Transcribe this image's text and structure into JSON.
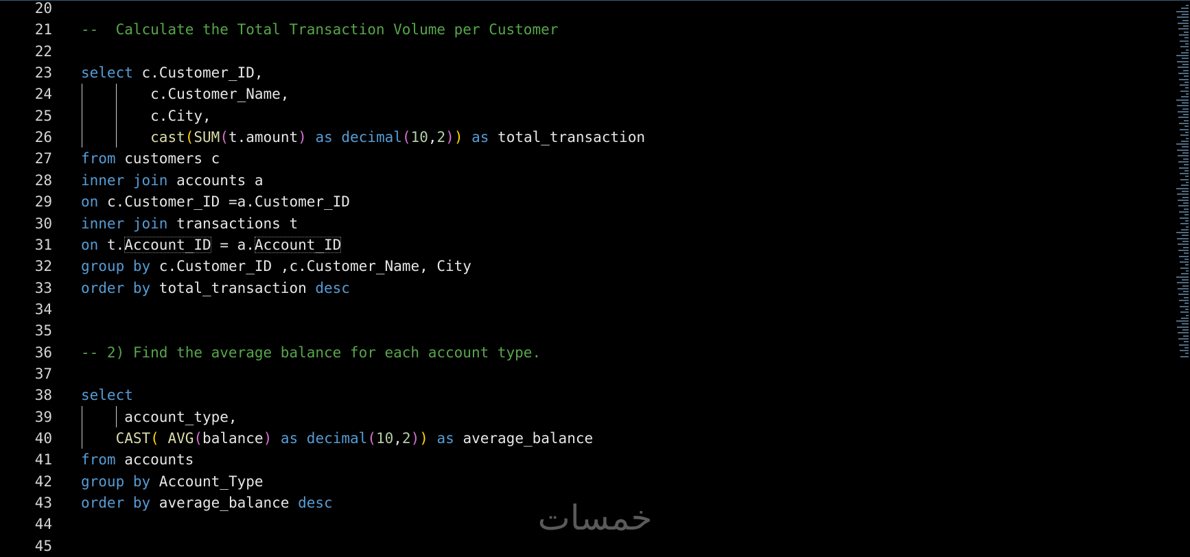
{
  "lines": [
    {
      "n": "20",
      "tokens": []
    },
    {
      "n": "21",
      "tokens": [
        {
          "t": "--  Calculate the Total Transaction Volume per Customer",
          "c": "cm"
        }
      ]
    },
    {
      "n": "22",
      "tokens": []
    },
    {
      "n": "23",
      "tokens": [
        {
          "t": "select",
          "c": "kw"
        },
        {
          "t": " c.Customer_ID,",
          "c": ""
        }
      ]
    },
    {
      "n": "24",
      "indent": "        ",
      "tokens": [
        {
          "t": "c.Customer_Name,",
          "c": ""
        }
      ]
    },
    {
      "n": "25",
      "indent": "        ",
      "tokens": [
        {
          "t": "c.City,",
          "c": ""
        }
      ]
    },
    {
      "n": "26",
      "indent": "        ",
      "tokens": [
        {
          "t": "cast",
          "c": "fn"
        },
        {
          "t": "(",
          "c": "p1"
        },
        {
          "t": "SUM",
          "c": "fn"
        },
        {
          "t": "(",
          "c": "p2"
        },
        {
          "t": "t.amount",
          "c": ""
        },
        {
          "t": ")",
          "c": "p2"
        },
        {
          "t": " as ",
          "c": "kw"
        },
        {
          "t": "decimal",
          "c": "kw"
        },
        {
          "t": "(",
          "c": "p2"
        },
        {
          "t": "10",
          "c": "num"
        },
        {
          "t": ",",
          "c": ""
        },
        {
          "t": "2",
          "c": "num"
        },
        {
          "t": ")",
          "c": "p2"
        },
        {
          "t": ")",
          "c": "p1"
        },
        {
          "t": " as",
          "c": "kw"
        },
        {
          "t": " total_transaction",
          "c": ""
        }
      ]
    },
    {
      "n": "27",
      "tokens": [
        {
          "t": "from",
          "c": "kw"
        },
        {
          "t": " customers c",
          "c": ""
        }
      ]
    },
    {
      "n": "28",
      "tokens": [
        {
          "t": "inner join",
          "c": "kw"
        },
        {
          "t": " accounts a",
          "c": ""
        }
      ]
    },
    {
      "n": "29",
      "tokens": [
        {
          "t": "on",
          "c": "kw"
        },
        {
          "t": " c.Customer_ID =a.Customer_ID",
          "c": ""
        }
      ]
    },
    {
      "n": "30",
      "tokens": [
        {
          "t": "inner join",
          "c": "kw"
        },
        {
          "t": " transactions t",
          "c": ""
        }
      ]
    },
    {
      "n": "31",
      "tokens": [
        {
          "t": "on",
          "c": "kw"
        },
        {
          "t": " t.",
          "c": ""
        },
        {
          "t": "Account_ID",
          "c": "",
          "hl": true
        },
        {
          "t": " = a.",
          "c": ""
        },
        {
          "t": "Account_ID",
          "c": "",
          "hl": true
        }
      ]
    },
    {
      "n": "32",
      "tokens": [
        {
          "t": "group by",
          "c": "kw"
        },
        {
          "t": " c.Customer_ID ,c.Customer_Name, City",
          "c": ""
        }
      ]
    },
    {
      "n": "33",
      "tokens": [
        {
          "t": "order by",
          "c": "kw"
        },
        {
          "t": " total_transaction ",
          "c": ""
        },
        {
          "t": "desc",
          "c": "kw"
        }
      ]
    },
    {
      "n": "34",
      "tokens": []
    },
    {
      "n": "35",
      "tokens": []
    },
    {
      "n": "36",
      "tokens": [
        {
          "t": "-- 2) Find the average balance for each account type.",
          "c": "cm"
        }
      ]
    },
    {
      "n": "37",
      "tokens": []
    },
    {
      "n": "38",
      "tokens": [
        {
          "t": "select",
          "c": "kw"
        }
      ]
    },
    {
      "n": "39",
      "indent": "     ",
      "tokens": [
        {
          "t": "account_type,",
          "c": ""
        }
      ]
    },
    {
      "n": "40",
      "indent": "    ",
      "tokens": [
        {
          "t": "CAST",
          "c": "fn"
        },
        {
          "t": "(",
          "c": "p1"
        },
        {
          "t": " AVG",
          "c": "fn"
        },
        {
          "t": "(",
          "c": "p2"
        },
        {
          "t": "balance",
          "c": ""
        },
        {
          "t": ")",
          "c": "p2"
        },
        {
          "t": " as ",
          "c": "kw"
        },
        {
          "t": "decimal",
          "c": "kw"
        },
        {
          "t": "(",
          "c": "p2"
        },
        {
          "t": "10",
          "c": "num"
        },
        {
          "t": ",",
          "c": ""
        },
        {
          "t": "2",
          "c": "num"
        },
        {
          "t": ")",
          "c": "p2"
        },
        {
          "t": ")",
          "c": "p1"
        },
        {
          "t": " as",
          "c": "kw"
        },
        {
          "t": " average_balance",
          "c": ""
        }
      ]
    },
    {
      "n": "41",
      "tokens": [
        {
          "t": "from",
          "c": "kw"
        },
        {
          "t": " accounts",
          "c": ""
        }
      ]
    },
    {
      "n": "42",
      "tokens": [
        {
          "t": "group by",
          "c": "kw"
        },
        {
          "t": " Account_Type",
          "c": ""
        }
      ]
    },
    {
      "n": "43",
      "tokens": [
        {
          "t": "order by",
          "c": "kw"
        },
        {
          "t": " average_balance ",
          "c": ""
        },
        {
          "t": "desc",
          "c": "kw"
        }
      ]
    },
    {
      "n": "44",
      "tokens": []
    },
    {
      "n": "45",
      "tokens": []
    }
  ],
  "watermark": {
    "text": "خمسات"
  },
  "colors": {
    "keyword": "#569cd6",
    "function": "#dcdcaa",
    "comment": "#57a64a",
    "number": "#b5cea8",
    "paren1": "#ffd700",
    "paren2": "#da70d6",
    "text": "#e6e6e6",
    "background": "#000000"
  }
}
